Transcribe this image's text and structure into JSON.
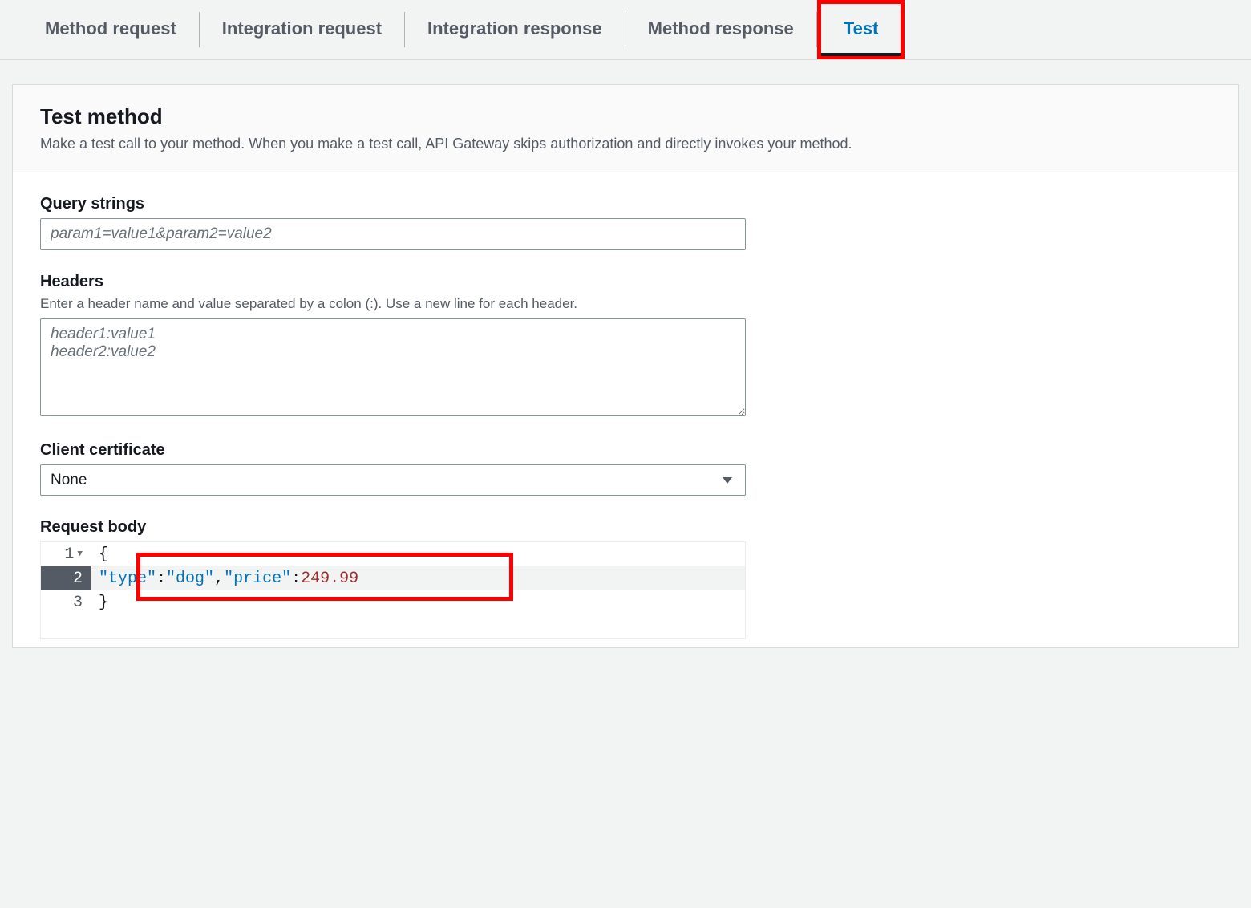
{
  "tabs": {
    "method_request": "Method request",
    "integration_request": "Integration request",
    "integration_response": "Integration response",
    "method_response": "Method response",
    "test": "Test"
  },
  "header": {
    "title": "Test method",
    "description": "Make a test call to your method. When you make a test call, API Gateway skips authorization and directly invokes your method."
  },
  "query_strings": {
    "label": "Query strings",
    "placeholder": "param1=value1&param2=value2"
  },
  "headers": {
    "label": "Headers",
    "hint": "Enter a header name and value separated by a colon (:). Use a new line for each header.",
    "placeholder": "header1:value1\nheader2:value2"
  },
  "client_cert": {
    "label": "Client certificate",
    "selected": "None"
  },
  "request_body": {
    "label": "Request body",
    "lines": {
      "l1_num": "1",
      "l2_num": "2",
      "l3_num": "3",
      "brace_open": "{",
      "brace_close": "}",
      "key_type": "\"type\"",
      "val_type": "\"dog\"",
      "key_price": "\"price\"",
      "val_price": "249.99",
      "colon": ":",
      "comma": ","
    }
  }
}
